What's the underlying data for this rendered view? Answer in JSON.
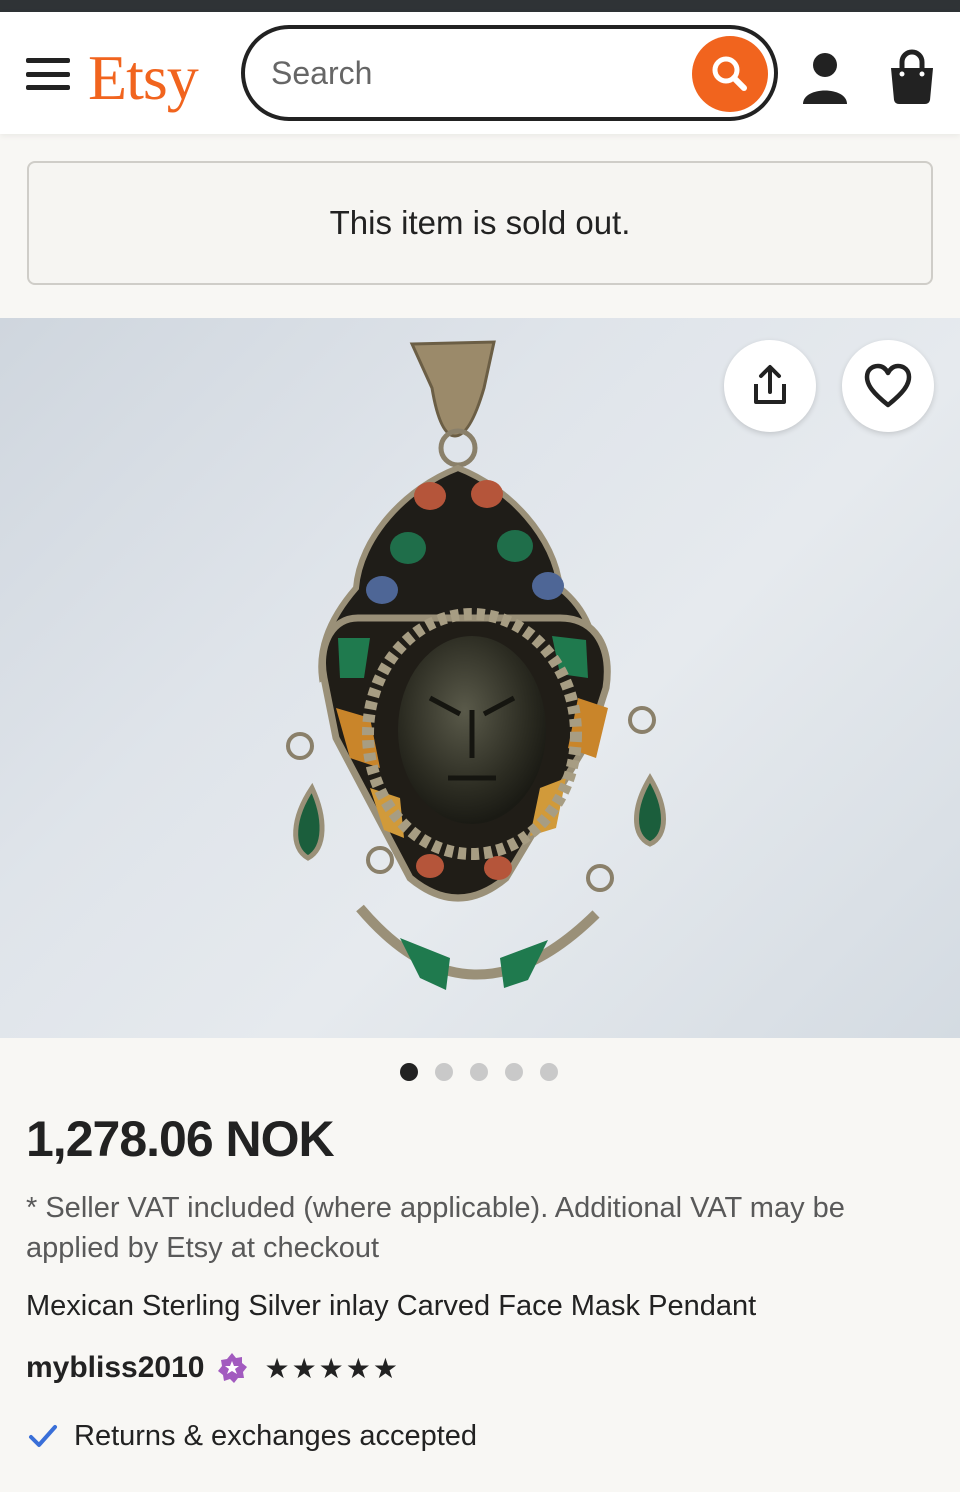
{
  "header": {
    "logo": "Etsy",
    "search": {
      "placeholder": "Search"
    },
    "icons": [
      "menu-icon",
      "search-icon",
      "user-icon",
      "shopping-bag-icon"
    ],
    "accent_color": "#f1641e"
  },
  "notice": {
    "sold_out_text": "This item is sold out."
  },
  "gallery": {
    "image_count": 5,
    "active_index": 0,
    "actions": [
      "share-icon",
      "heart-icon"
    ]
  },
  "listing": {
    "price": "1,278.06 NOK",
    "vat_note": "* Seller VAT included (where applicable). Additional VAT may be applied by Etsy at checkout",
    "title": "Mexican Sterling Silver inlay Carved Face Mask Pendant",
    "seller": "mybliss2010",
    "seller_badge": "star-seller-icon",
    "rating": 5,
    "rating_display": "★★★★★",
    "returns": "Returns & exchanges accepted"
  }
}
